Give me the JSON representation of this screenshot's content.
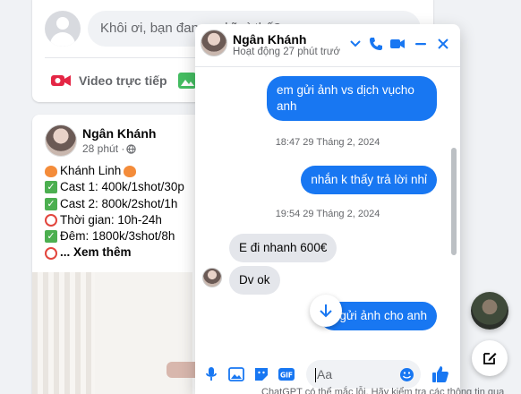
{
  "composer": {
    "placeholder": "Khôi ơi, bạn đang nghĩ gì thế?",
    "live_video_label": "Video trực tiếp"
  },
  "post": {
    "author": "Ngân Khánh",
    "time": "28 phút ·",
    "lines": [
      {
        "icon": "peach-icon",
        "text": "Khánh Linh"
      },
      {
        "icon": "check-icon",
        "text": "Cast 1: 400k/1shot/30p"
      },
      {
        "icon": "check-icon",
        "text": "Cast 2: 800k/2shot/1h"
      },
      {
        "icon": "alarm-clock-icon",
        "text": "Thời gian: 10h-24h"
      },
      {
        "icon": "check-icon",
        "text": "Đêm: 1800k/3shot/8h"
      }
    ],
    "see_more": "... Xem thêm"
  },
  "chat": {
    "name": "Ngân Khánh",
    "status": "Hoạt động 27 phút trướ",
    "messages": [
      {
        "dir": "out",
        "text": "em gửi ảnh vs dịch vụcho anh"
      },
      {
        "type": "time",
        "text": "18:47 29 Tháng 2, 2024"
      },
      {
        "dir": "out",
        "text": "nhắn k thấy trả lời nhỉ"
      },
      {
        "type": "time",
        "text": "19:54 29 Tháng 2, 2024"
      },
      {
        "dir": "in",
        "text": "E đi nhanh 600€"
      },
      {
        "dir": "in",
        "text": "Dv ok"
      },
      {
        "dir": "out",
        "text": "gửi ảnh cho anh"
      }
    ],
    "input_placeholder": "Aa"
  },
  "bottom_hint": "ChatGPT có thể mắc lỗi. Hãy kiểm tra các thông tin qua",
  "colors": {
    "accent": "#1877f2",
    "bubble_in": "#e4e6eb",
    "page_bg": "#f0f2f5",
    "live_red": "#e42645",
    "photo_green": "#45bd62"
  }
}
